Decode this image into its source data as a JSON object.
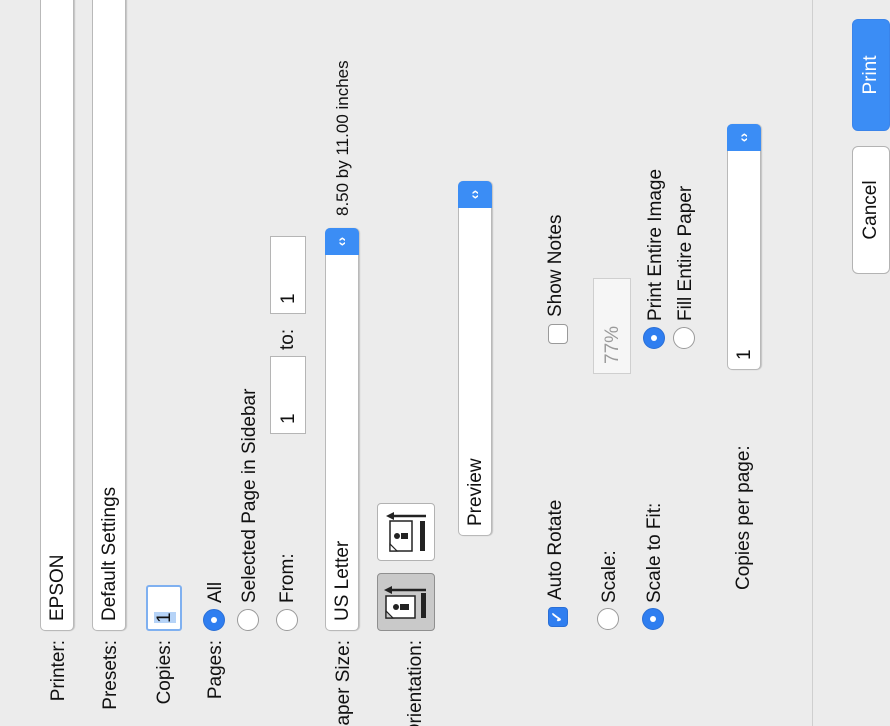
{
  "printer": {
    "label": "Printer:",
    "value": "EPSON"
  },
  "presets": {
    "label": "Presets:",
    "value": "Default Settings"
  },
  "copies": {
    "label": "Copies:",
    "value": "1"
  },
  "pages": {
    "label": "Pages:",
    "all_label": "All",
    "selected_label": "Selected Page in Sidebar",
    "from_label": "From:",
    "from_value": "1",
    "to_label": "to:",
    "to_value": "1",
    "selected_option": "All"
  },
  "paper_size": {
    "label": "Paper Size:",
    "value": "US Letter",
    "dimensions": "8.50 by 11.00 inches"
  },
  "orientation": {
    "label": "Orientation:",
    "selected": "portrait"
  },
  "section": {
    "value": "Preview"
  },
  "preview_options": {
    "auto_rotate_label": "Auto Rotate",
    "auto_rotate_checked": true,
    "show_notes_label": "Show Notes",
    "show_notes_checked": false,
    "scale_label": "Scale:",
    "scale_value": "77%",
    "scale_to_fit_label": "Scale to Fit:",
    "selected_scaling": "Scale to Fit",
    "print_entire_image_label": "Print Entire Image",
    "fill_entire_paper_label": "Fill Entire Paper",
    "fit_mode": "Print Entire Image",
    "copies_per_page_label": "Copies per page:",
    "copies_per_page_value": "1"
  },
  "buttons": {
    "cancel": "Cancel",
    "print": "Print"
  },
  "colors": {
    "accent": "#3b8df5",
    "background": "#ececec"
  }
}
